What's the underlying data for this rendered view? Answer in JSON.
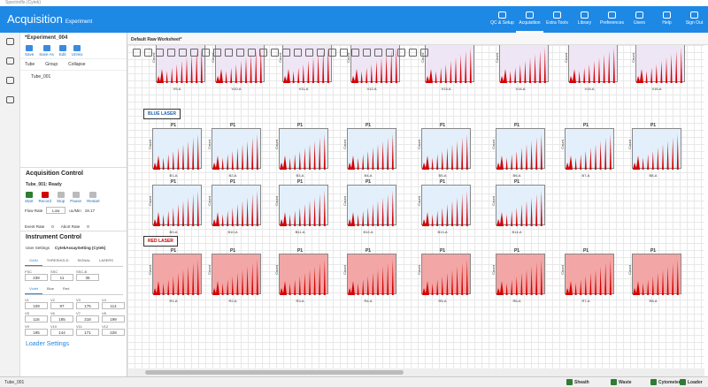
{
  "window": {
    "title": "Spectroflo (Cytek)"
  },
  "header": {
    "title": "Acquisition",
    "subtitle": "Experiment",
    "nav": [
      {
        "label": "QC & Setup"
      },
      {
        "label": "Acquisition",
        "active": true
      },
      {
        "label": "Extra Tools"
      },
      {
        "label": "Library"
      },
      {
        "label": "Preferences"
      },
      {
        "label": "Users"
      },
      {
        "label": "Help"
      },
      {
        "label": "Sign Out"
      }
    ]
  },
  "experiment": {
    "name": "*Experiment_004",
    "actions": [
      "Save",
      "Save As",
      "Edit",
      "Unmix"
    ],
    "tree_header": [
      "Tube",
      "Group",
      "Collapse"
    ],
    "tube": "Tube_001"
  },
  "acquisition": {
    "title": "Acquisition Control",
    "status": "Tube_001: Ready",
    "buttons": [
      "Start",
      "Record",
      "Stop",
      "Pause",
      "Restart"
    ],
    "flow_rate_label": "Flow Rate",
    "flow_rate": "Low",
    "unit": "uL/Min",
    "flow_value": "19.17",
    "event_rate_label": "Event Rate",
    "event_rate": "0",
    "abort_rate_label": "Abort Rate",
    "abort_rate": "0"
  },
  "instrument": {
    "title": "Instrument Control",
    "settings_label": "User Settings",
    "settings_value": "CytekAssaySetting (Cytek)",
    "tabs": [
      "GAIN",
      "THRESHOLD",
      "SIGNAL",
      "LASERS"
    ],
    "scatter": [
      {
        "n": "FSC",
        "v": "238"
      },
      {
        "n": "SSC",
        "v": "11"
      },
      {
        "n": "SSC-B",
        "v": "35"
      }
    ],
    "subtabs": [
      "Violet",
      "Blue",
      "Red"
    ],
    "channels": [
      {
        "n": "V1",
        "v": "109"
      },
      {
        "n": "V2",
        "v": "97"
      },
      {
        "n": "V3",
        "v": "175"
      },
      {
        "n": "V4",
        "v": "114"
      },
      {
        "n": "V5",
        "v": "116"
      },
      {
        "n": "V6",
        "v": "185"
      },
      {
        "n": "V7",
        "v": "218"
      },
      {
        "n": "V8",
        "v": "199"
      },
      {
        "n": "V9",
        "v": "195"
      },
      {
        "n": "V10",
        "v": "144"
      },
      {
        "n": "V11",
        "v": "171"
      },
      {
        "n": "V12",
        "v": "228"
      }
    ]
  },
  "loader": {
    "title": "Loader Settings"
  },
  "worksheet": {
    "tab": "Default Raw Worksheet*"
  },
  "plots": {
    "row1": [
      "V9-A",
      "V10-A",
      "V11-A",
      "V12-A",
      "V13-A",
      "V14-A",
      "V15-A",
      "V16-A"
    ],
    "row2": [
      "B1-A",
      "B2-A",
      "B3-A",
      "B4-A",
      "B5-A",
      "B6-A",
      "B7-A",
      "B8-A"
    ],
    "row3": [
      "B9-A",
      "B10-A",
      "B11-A",
      "B12-A",
      "B13-A",
      "B14-A"
    ],
    "row4": [
      "R1-A",
      "R2-A",
      "R3-A",
      "R4-A",
      "R5-A",
      "R6-A",
      "R7-A",
      "R8-A"
    ],
    "gate": "P1",
    "ylabel": "Count"
  },
  "lasers": {
    "blue": "BLUE LASER",
    "red": "RED LASER"
  },
  "status": {
    "tube": "Tube_001",
    "items": [
      "Sheath",
      "Waste",
      "Cytometer",
      "Loader"
    ]
  },
  "colors": {
    "header": "#1e88e5",
    "violet_bg": "#efe6f5",
    "blue_bg": "#e3f0fb",
    "red_bg": "#f2a6a6",
    "peak": "#d40000"
  }
}
